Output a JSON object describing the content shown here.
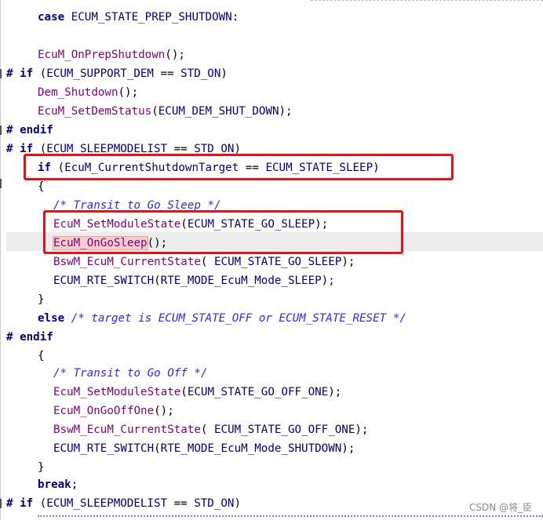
{
  "code_lines": [
    {
      "t": "        case ECUM_STATE_PREP_SHUTDOWN:"
    },
    {
      "t": ""
    },
    {
      "t": "        EcuM_OnPrepShutdown();"
    },
    {
      "t": "# if (ECUM_SUPPORT_DEM == STD_ON)"
    },
    {
      "t": "        Dem_Shutdown();"
    },
    {
      "t": "        EcuM_SetDemStatus(ECUM_DEM_SHUT_DOWN);"
    },
    {
      "t": "# endif"
    },
    {
      "t": "# if (ECUM_SLEEPMODELIST == STD_ON)"
    },
    {
      "t": "        if (EcuM_CurrentShutdownTarget == ECUM_STATE_SLEEP)"
    },
    {
      "t": "        {"
    },
    {
      "t": "          /* Transit to Go Sleep */"
    },
    {
      "t": "          EcuM_SetModuleState(ECUM_STATE_GO_SLEEP);"
    },
    {
      "t": "          EcuM_OnGoSleep();"
    },
    {
      "t": "          BswM_EcuM_CurrentState( ECUM_STATE_GO_SLEEP);"
    },
    {
      "t": "          ECUM_RTE_SWITCH(RTE_MODE_EcuM_Mode_SLEEP);"
    },
    {
      "t": "        }"
    },
    {
      "t": "        else /* target is ECUM_STATE_OFF or ECUM_STATE_RESET */"
    },
    {
      "t": "# endif"
    },
    {
      "t": "        {"
    },
    {
      "t": "          /* Transit to Go Off */"
    },
    {
      "t": "          EcuM_SetModuleState(ECUM_STATE_GO_OFF_ONE);"
    },
    {
      "t": "          EcuM_OnGoOffOne();"
    },
    {
      "t": "          BswM_EcuM_CurrentState( ECUM_STATE_GO_OFF_ONE);"
    },
    {
      "t": "          ECUM_RTE_SWITCH(RTE_MODE_EcuM_Mode_SHUTDOWN);"
    },
    {
      "t": "        }"
    },
    {
      "t": "        break;"
    },
    {
      "t": "# if (ECUM_SLEEPMODELIST == STD_ON)"
    }
  ],
  "tokens": {
    "l0": [
      "case",
      "ECUM_STATE_PREP_SHUTDOWN",
      ":"
    ],
    "l2": [
      "EcuM_OnPrepShutdown",
      "();"
    ],
    "l3": [
      "#",
      "if",
      "(",
      "ECUM_SUPPORT_DEM",
      " == ",
      "STD_ON",
      ")"
    ],
    "l4": [
      "Dem_Shutdown",
      "();"
    ],
    "l5": [
      "EcuM_SetDemStatus",
      "(",
      "ECUM_DEM_SHUT_DOWN",
      ");"
    ],
    "l6": [
      "#",
      "endif"
    ],
    "l7": [
      "#",
      "if",
      "(",
      "ECUM_SLEEPMODELIST",
      " == ",
      "STD_ON",
      ")"
    ],
    "l8": [
      "if",
      "(",
      "EcuM_CurrentShutdownTarget",
      " == ",
      "ECUM_STATE_SLEEP",
      ")"
    ],
    "l9": [
      "{"
    ],
    "l10": [
      "/* Transit to Go Sleep */"
    ],
    "l11": [
      "EcuM_SetModuleState",
      "(",
      "ECUM_STATE_GO_SLEEP",
      ");"
    ],
    "l12": [
      "EcuM_OnGoSleep",
      "();"
    ],
    "l13": [
      "BswM_EcuM_CurrentState",
      "( ",
      "ECUM_STATE_GO_SLEEP",
      ");"
    ],
    "l14": [
      "ECUM_RTE_SWITCH",
      "(",
      "RTE_MODE_EcuM_Mode_SLEEP",
      ");"
    ],
    "l15": [
      "}"
    ],
    "l16": [
      "else",
      "/* target is ECUM_STATE_OFF or ECUM_STATE_RESET */"
    ],
    "l17": [
      "#",
      "endif"
    ],
    "l18": [
      "{"
    ],
    "l19": [
      "/* Transit to Go Off */"
    ],
    "l20": [
      "EcuM_SetModuleState",
      "(",
      "ECUM_STATE_GO_OFF_ONE",
      ");"
    ],
    "l21": [
      "EcuM_OnGoOffOne",
      "();"
    ],
    "l22": [
      "BswM_EcuM_CurrentState",
      "( ",
      "ECUM_STATE_GO_OFF_ONE",
      ");"
    ],
    "l23": [
      "ECUM_RTE_SWITCH",
      "(",
      "RTE_MODE_EcuM_Mode_SHUTDOWN",
      ");"
    ],
    "l24": [
      "}"
    ],
    "l25": [
      "break",
      ";"
    ],
    "l26": [
      "#",
      "if",
      "(",
      "ECUM_SLEEPMODELIST",
      " == ",
      "STD_ON",
      ")"
    ]
  },
  "colors": {
    "annotation_box": "#e5121b",
    "keyword": "#00007f",
    "function": "#7f007f",
    "comment": "#2a2aff",
    "current_line": "#ececec"
  },
  "watermark": "CSDN @将_臣"
}
